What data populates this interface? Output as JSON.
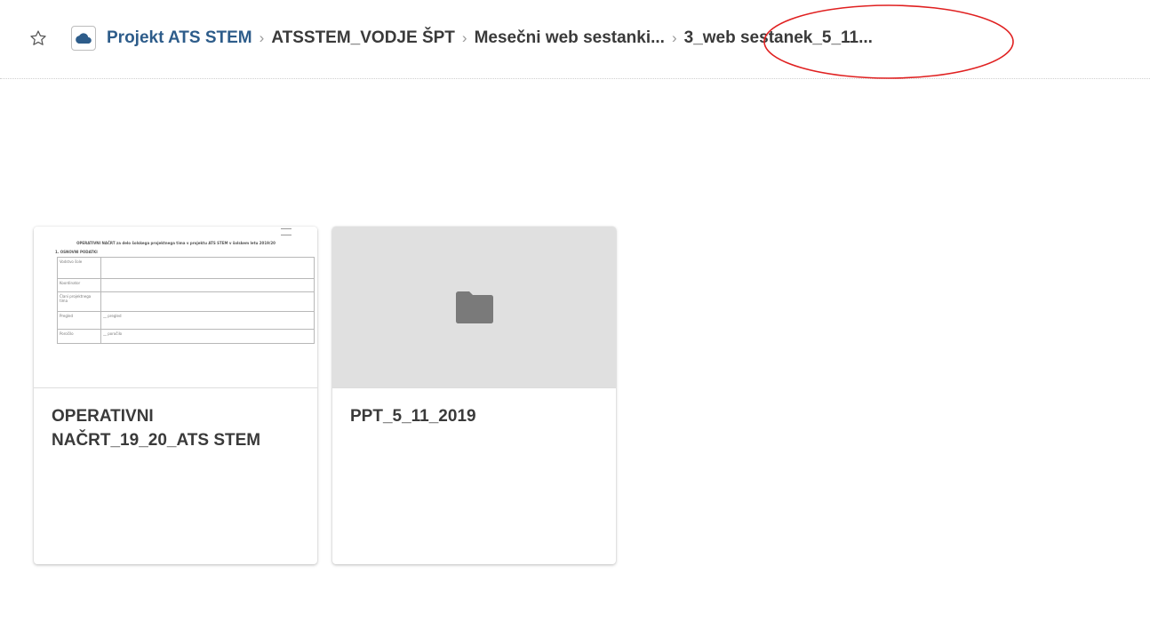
{
  "header": {
    "star_icon": "star-outline-icon",
    "cloud_icon": "cloud-icon",
    "breadcrumbs": [
      "Projekt ATS STEM",
      "ATSSTEM_VODJE ŠPT",
      "Mesečni web sestanki...",
      "3_web sestanek_5_11..."
    ],
    "separator": "›"
  },
  "colors": {
    "root_crumb": "#2d5c8a",
    "highlight": "#e02020",
    "folder_thumb_bg": "#e0e0e0",
    "folder_icon": "#7a7a7a"
  },
  "files": [
    {
      "title": "OPERATIVNI\nNAČRT_19_20_ATS STEM",
      "type": "document",
      "preview": {
        "heading": "OPERATIVNI NAČRT za delo šolskega projektnega tima v projektu ATS STEM v šolskem letu 2019/20",
        "section": "1. OSNOVNI PODATKI",
        "rows": [
          {
            "label": "Vodstvo šole",
            "value": ""
          },
          {
            "label": "Koordinator",
            "value": ""
          },
          {
            "label": "Člani projektnega tima",
            "value": ""
          },
          {
            "label": "Pregled",
            "value": "__ pregled"
          },
          {
            "label": "Poročilo",
            "value": "__ poročilo"
          }
        ]
      }
    },
    {
      "title": "PPT_5_11_2019",
      "type": "folder",
      "icon": "folder-icon"
    }
  ]
}
